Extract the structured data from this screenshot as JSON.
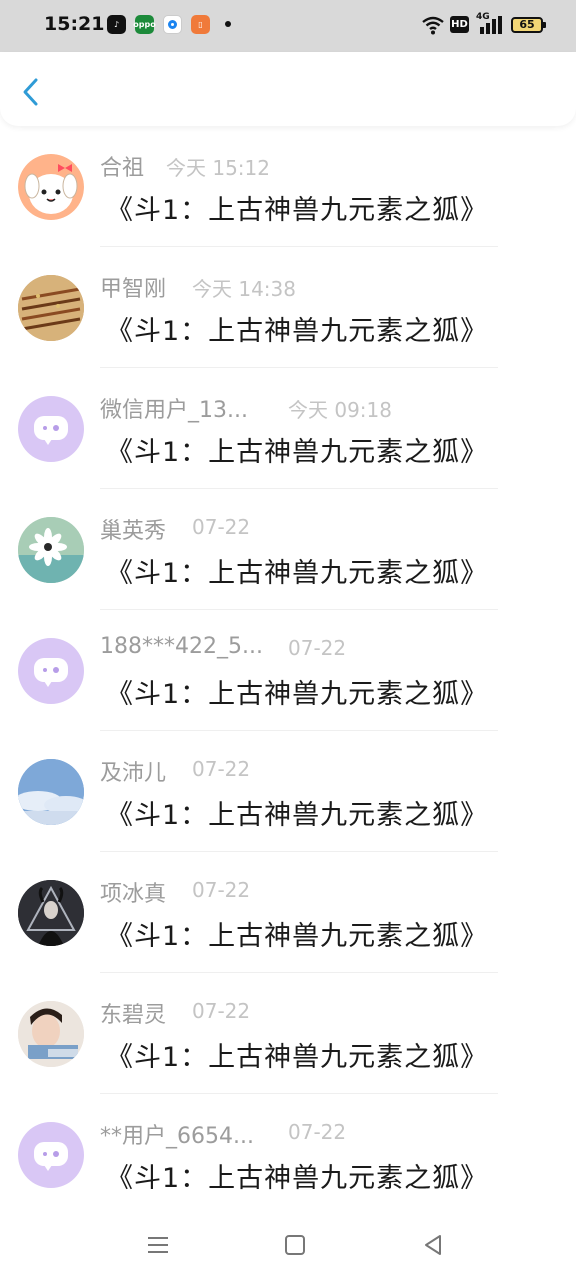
{
  "status_bar": {
    "time": "15:21",
    "battery": "65",
    "network": "4G",
    "hd": "HD"
  },
  "header": {
    "back_icon": "chevron-left-icon"
  },
  "items": [
    {
      "name": "合祖",
      "time": "今天 15:12",
      "title": "《斗1：上古神兽九元素之狐》",
      "avatar": "cartoon"
    },
    {
      "name": "甲智刚",
      "time": "今天 14:38",
      "title": "《斗1：上古神兽九元素之狐》",
      "avatar": "photo"
    },
    {
      "name": "微信用户_13...",
      "time": "今天 09:18",
      "title": "《斗1：上古神兽九元素之狐》",
      "avatar": "default"
    },
    {
      "name": "巢英秀",
      "time": "07-22",
      "title": "《斗1：上古神兽九元素之狐》",
      "avatar": "photo"
    },
    {
      "name": "188***422_5...",
      "time": "07-22",
      "title": "《斗1：上古神兽九元素之狐》",
      "avatar": "default"
    },
    {
      "name": "及沛儿",
      "time": "07-22",
      "title": "《斗1：上古神兽九元素之狐》",
      "avatar": "photo"
    },
    {
      "name": "项冰真",
      "time": "07-22",
      "title": "《斗1：上古神兽九元素之狐》",
      "avatar": "photo"
    },
    {
      "name": "东碧灵",
      "time": "07-22",
      "title": "《斗1：上古神兽九元素之狐》",
      "avatar": "photo"
    },
    {
      "name": "**用户_6654...",
      "time": "07-22",
      "title": "《斗1：上古神兽九元素之狐》",
      "avatar": "default"
    }
  ],
  "system_nav": {
    "menu_icon": "menu-icon",
    "home_icon": "home-icon",
    "back_icon": "back-triangle-icon"
  },
  "colors": {
    "accent": "#2f9bd6",
    "default_avatar": "#d9c7f5"
  }
}
